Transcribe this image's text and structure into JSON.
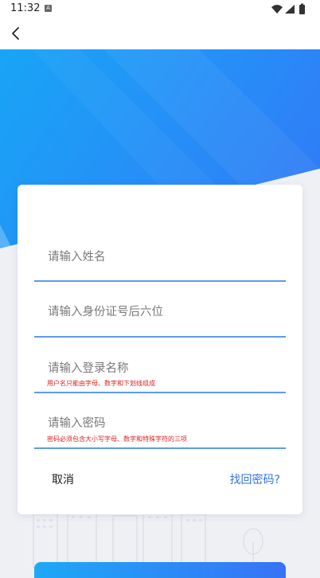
{
  "status_bar": {
    "time": "11:32",
    "notification_letter": "A"
  },
  "form": {
    "name_placeholder": "请输入姓名",
    "id_placeholder": "请输入身份证号后六位",
    "username_placeholder": "请输入登录名称",
    "username_hint": "用户名只能由字母、数字和下划线组成",
    "password_placeholder": "请输入密码",
    "password_hint": "密码必须包含大小写字母、数字和特殊字符的三项"
  },
  "actions": {
    "cancel_label": "取消",
    "forgot_label": "找回密码?"
  },
  "colors": {
    "accent": "#2f73e6",
    "gradient_start": "#18a5f6",
    "gradient_end": "#3574f6",
    "hint": "#e02020"
  },
  "icons": [
    "back-arrow-icon",
    "wifi-icon",
    "signal-icon",
    "battery-icon"
  ]
}
